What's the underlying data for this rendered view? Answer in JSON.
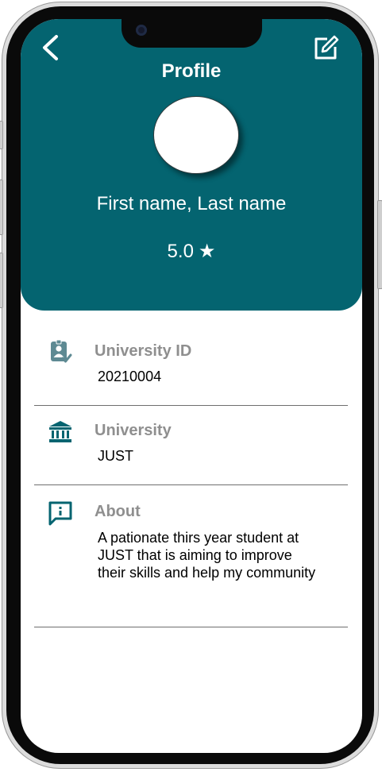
{
  "header": {
    "title": "Profile",
    "back_icon": "chevron-left-icon",
    "edit_icon": "edit-icon"
  },
  "profile": {
    "name": "First name, Last name",
    "rating": "5.0",
    "rating_icon": "star-icon"
  },
  "fields": {
    "university_id": {
      "label": "University ID",
      "value": "20210004",
      "icon": "id-badge-icon"
    },
    "university": {
      "label": "University",
      "value": "JUST",
      "icon": "institution-icon"
    },
    "about": {
      "label": "About",
      "value": "A pationate thirs year student at JUST that is aiming to improve their skills and help my community",
      "icon": "info-message-icon"
    }
  },
  "colors": {
    "header_bg": "#046470",
    "icon": "#046470",
    "label": "#8f8f8f",
    "divider": "#6f6f6f"
  }
}
